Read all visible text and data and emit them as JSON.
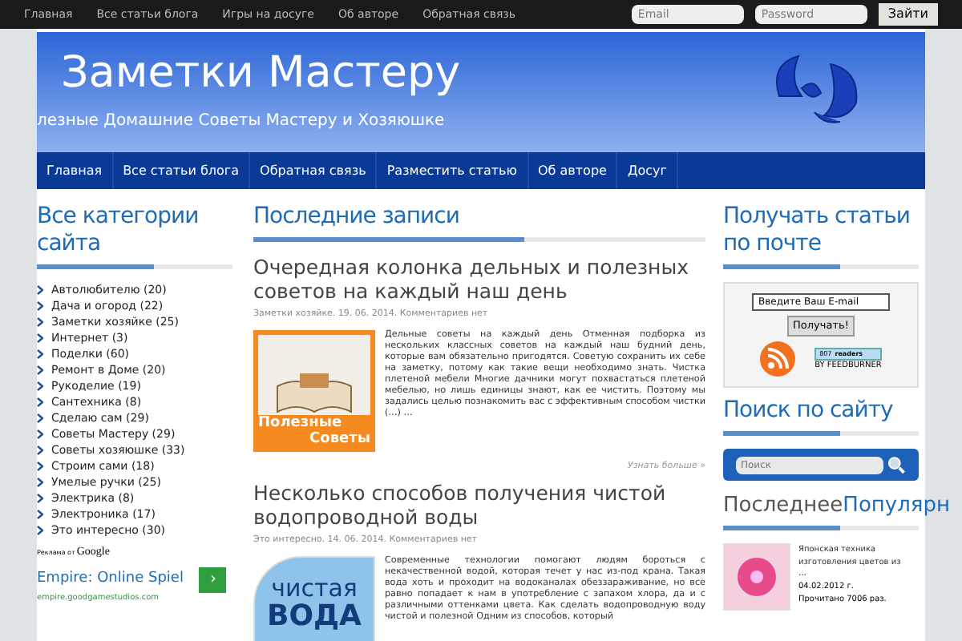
{
  "top_bar": {
    "links": [
      "Главная",
      "Все статьи блога",
      "Игры на досуге",
      "Об авторе",
      "Обратная связь"
    ],
    "email_placeholder": "Email",
    "password_placeholder": "Password",
    "login_button": "Зайти"
  },
  "header": {
    "title": "Заметки Мастеру",
    "tagline": "лезные Домашние Советы Мастеру и Хозяюшке"
  },
  "nav": [
    {
      "label": "Главная",
      "selected": false
    },
    {
      "label": "Все статьи блога",
      "selected": false
    },
    {
      "label": "Обратная связь",
      "selected": false
    },
    {
      "label": "Разместить статью",
      "selected": false
    },
    {
      "label": "Об авторе",
      "selected": false
    },
    {
      "label": "Досуг",
      "selected": false
    }
  ],
  "left_sidebar": {
    "title": "Все категории сайта",
    "categories": [
      "Автолюбителю (20)",
      "Дача и огород (22)",
      "Заметки хозяйке (25)",
      "Интернет (3)",
      "Поделки (60)",
      "Ремонт в Доме (20)",
      "Рукоделие (19)",
      "Сантехника (8)",
      "Сделаю сам (29)",
      "Советы Мастеру (29)",
      "Советы хозяюшке (33)",
      "Строим сами (18)",
      "Умелые ручки (25)",
      "Электрика (8)",
      "Электроника (17)",
      "Это интересно (30)"
    ],
    "ad_label": "Реклама от",
    "ad_brand": "Google",
    "ad_title": "Empire: Online Spiel",
    "ad_button": "›",
    "ad_url": "empire.goodgamestudios.com"
  },
  "main": {
    "title": "Последние записи",
    "posts": [
      {
        "title": "Очередная колонка дельных и полезных советов на каждый наш день",
        "meta": "Заметки хозяйке. 19. 06. 2014. Комментариев нет",
        "kind": "tips",
        "image_caption_1": "Полезные",
        "image_caption_2": "Советы",
        "body": "Дельные советы на каждый день Отменная подборка из нескольких классных советов на каждый наш будний день, которые вам обязательно пригодятся. Советую сохранить их себе на заметку, потому как такие вещи необходимо знать. Чистка плетеной мебели Многие дачники могут похвастаться плетеной мебелью, но лишь единицы знают, как ее чистить. Поэтому мы задались целью познакомить вас с эффективным способом чистки (…) …",
        "more": "Узнать больше »"
      },
      {
        "title": "Несколько способов получения чистой водопроводной воды",
        "meta": "Это интересно. 14. 06. 2014. Комментариев нет",
        "kind": "water",
        "image_caption_1": "чистая",
        "image_caption_2": "ВОДА",
        "body": "Современные технологии помогают людям бороться с некачественной водой, которая течет у нас из-под крана. Такая вода хоть и проходит на водоканалах обеззараживание, но все равно попадает к нам в употребление с запахом хлора, да и с различными оттенками цвета. Как сделать водопроводную воду чистой и полезной Одним из способов, который"
      }
    ]
  },
  "right_sidebar": {
    "subscribe_title": "Получать статьи по почте",
    "email_value": "Введите Ваш E-mail",
    "subscribe_button": "Получать!",
    "readers_count": "807",
    "readers_label": "readers",
    "readers_by": "BY FEEDBURNER",
    "search_title": "Поиск по сайту",
    "search_placeholder": "Поиск",
    "tabs": [
      {
        "label": "Последнее",
        "selected": true
      },
      {
        "label": "Популярн",
        "selected": false
      }
    ],
    "recent": {
      "title": "Японская техника изготовления цветов из",
      "ellipsis": "…",
      "date": "04.02.2012 г.",
      "views": "Прочитано 7006 раз."
    }
  }
}
